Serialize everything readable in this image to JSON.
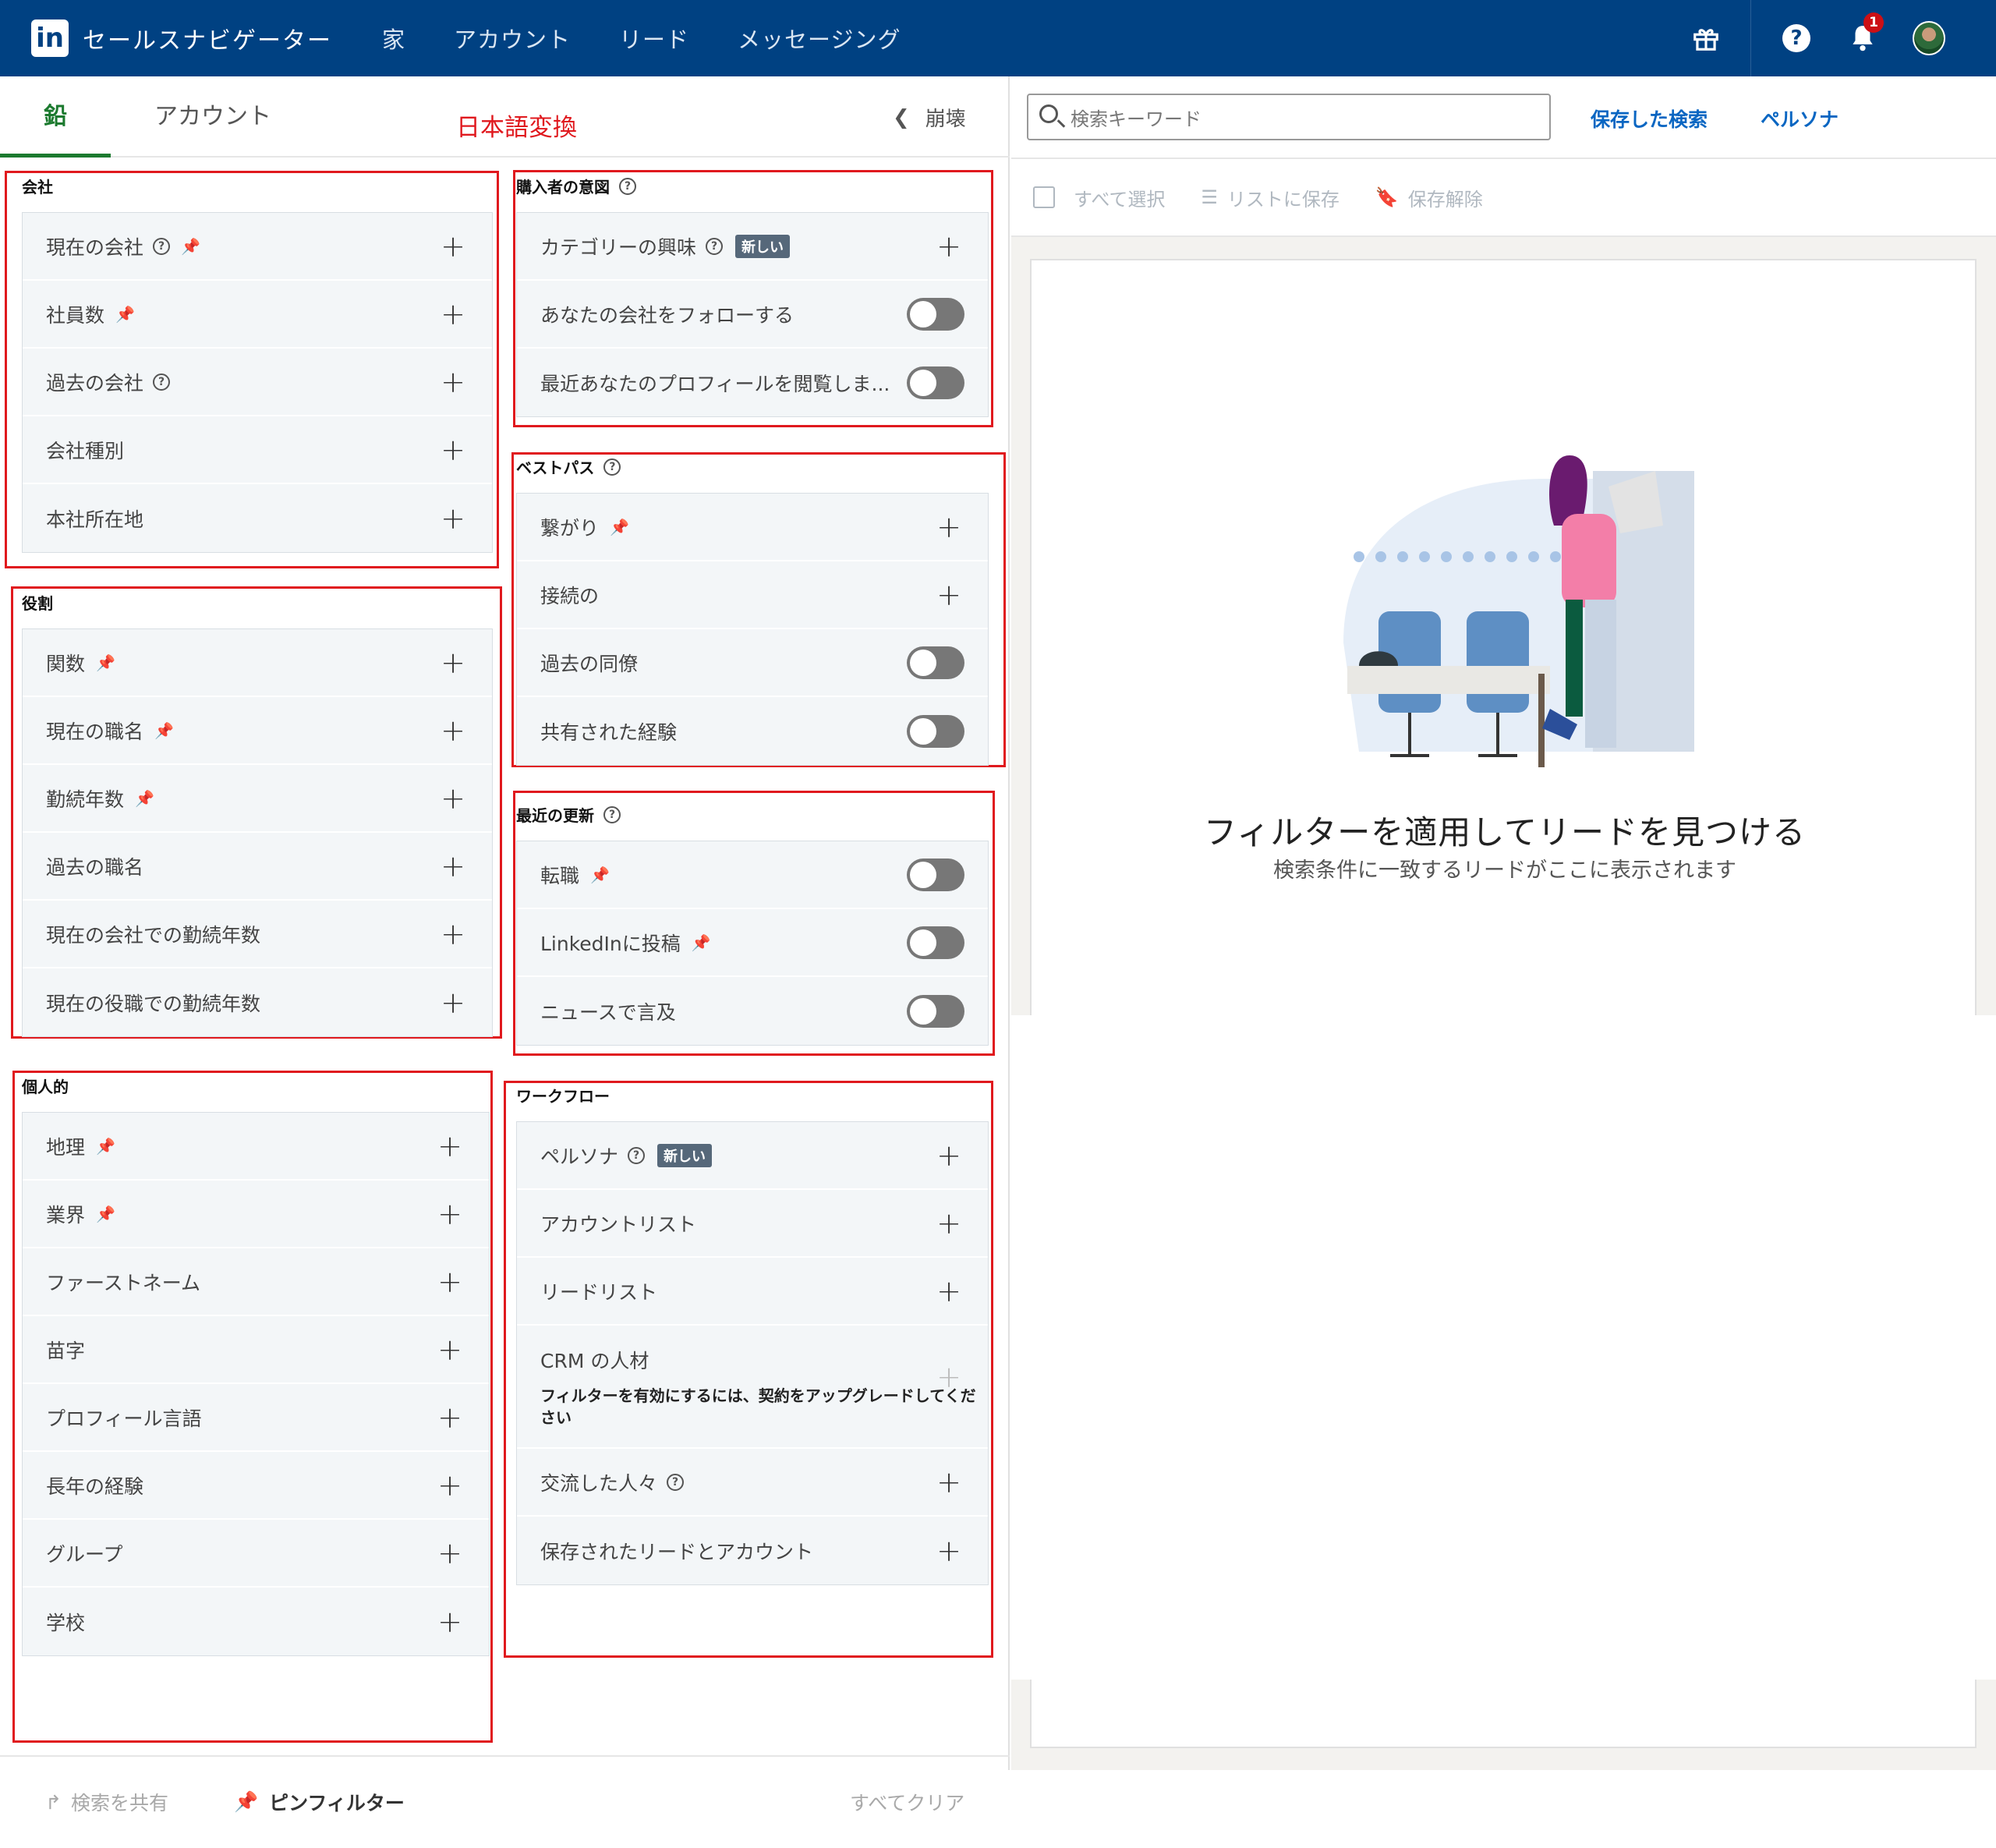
{
  "header": {
    "logo_text": "in",
    "app_name": "セールスナビゲーター",
    "nav": [
      "家",
      "アカウント",
      "リード",
      "メッセージング"
    ],
    "notification_count": "1",
    "icons": [
      "gift-icon",
      "help-icon",
      "bell-icon",
      "avatar"
    ]
  },
  "left": {
    "tab_lead": "鉛",
    "tab_account": "アカウント",
    "annotation": "日本語変換",
    "collapse_label": "崩壊",
    "sections": {
      "company": {
        "title": "会社",
        "rows": [
          "現在の会社",
          "社員数",
          "過去の会社",
          "会社種別",
          "本社所在地"
        ]
      },
      "role": {
        "title": "役割",
        "rows": [
          "関数",
          "現在の職名",
          "勤続年数",
          "過去の職名",
          "現在の会社での勤続年数",
          "現在の役職での勤続年数"
        ]
      },
      "personal": {
        "title": "個人的",
        "rows": [
          "地理",
          "業界",
          "ファーストネーム",
          "苗字",
          "プロフィール言語",
          "長年の経験",
          "グループ",
          "学校"
        ]
      },
      "buyer": {
        "title": "購入者の意図",
        "rows": [
          "カテゴリーの興味",
          "あなたの会社をフォローする",
          "最近あなたのプロフィールを閲覧しま..."
        ],
        "new_badge": "新しい"
      },
      "bestpath": {
        "title": "ベストパス",
        "rows": [
          "繋がり",
          "接続の",
          "過去の同僚",
          "共有された経験"
        ]
      },
      "recent": {
        "title": "最近の更新",
        "rows": [
          "転職",
          "LinkedInに投稿",
          "ニュースで言及"
        ]
      },
      "workflow": {
        "title": "ワークフロー",
        "rows": [
          "ペルソナ",
          "アカウントリスト",
          "リードリスト",
          "CRM の人材",
          "交流した人々",
          "保存されたリードとアカウント"
        ],
        "new_badge": "新しい",
        "crm_note": "フィルターを有効にするには、契約をアップグレードしてください"
      }
    },
    "footer": {
      "share": "検索を共有",
      "pin": "ピンフィルター",
      "clear": "すべてクリア"
    }
  },
  "right": {
    "search_placeholder": "検索キーワード",
    "saved_searches": "保存した検索",
    "persona": "ペルソナ",
    "select_all": "すべて選択",
    "save_to_list": "リストに保存",
    "unsave": "保存解除",
    "empty_title": "フィルターを適用してリードを見つける",
    "empty_subtitle": "検索条件に一致するリードがここに表示されます"
  },
  "colors": {
    "nav_bg": "#004182",
    "accent_green": "#1c7a2f",
    "link_blue": "#0a66c2",
    "annotation_red": "#e0191e"
  }
}
